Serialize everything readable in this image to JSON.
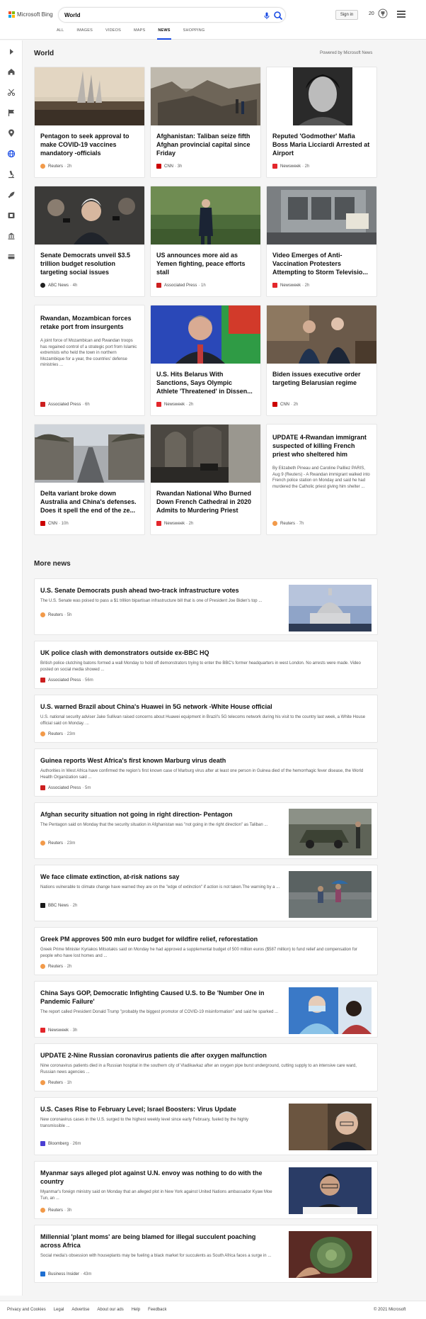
{
  "app": {
    "logo_text": "Microsoft Bing",
    "logo_colors": [
      "#f25022",
      "#7fba00",
      "#00a4ef",
      "#ffb900"
    ],
    "search_value": "World",
    "signin_label": "Sign in",
    "points": "20",
    "accent": "#174ae4"
  },
  "nav": {
    "tabs": [
      {
        "label": "ALL"
      },
      {
        "label": "IMAGES"
      },
      {
        "label": "VIDEOS"
      },
      {
        "label": "MAPS"
      },
      {
        "label": "NEWS",
        "active": true
      },
      {
        "label": "SHOPPING"
      }
    ]
  },
  "rail": {
    "icons": [
      "expand-icon",
      "home-icon",
      "scissors-icon",
      "flag-icon",
      "map-pin-icon",
      "globe-icon",
      "microscope-icon",
      "rocket-icon",
      "film-icon",
      "bank-icon",
      "card-icon"
    ]
  },
  "main": {
    "section_title": "World",
    "powered": "Powered by Microsoft News",
    "cards": [
      {
        "headline": "Pentagon to seek approval to make COVID-19 vaccines mandatory -officials",
        "source": "Reuters",
        "time": "· 2h",
        "icon": "reuters"
      },
      {
        "headline": "Afghanistan: Taliban seize fifth Afghan provincial capital since Friday",
        "source": "CNN",
        "time": "· 3h",
        "icon": "cnn"
      },
      {
        "headline": "Reputed 'Godmother' Mafia Boss Maria Licciardi Arrested at Airport",
        "source": "Newsweek",
        "time": "· 2h",
        "icon": "newsweek"
      },
      {
        "headline": "Senate Democrats unveil $3.5 trillion budget resolution targeting social issues",
        "source": "ABC News",
        "time": "· 4h",
        "icon": "abc"
      },
      {
        "headline": "US announces more aid as Yemen fighting, peace efforts stall",
        "source": "Associated Press",
        "time": "· 1h",
        "icon": "ap"
      },
      {
        "headline": "Video Emerges of Anti-Vaccination Protesters Attempting to Storm Televisio...",
        "source": "Newsweek",
        "time": "· 2h",
        "icon": "newsweek"
      },
      {
        "headline": "Rwandan, Mozambican forces retake port from insurgents",
        "snippet": "A joint force of Mozambican and Rwandan troops has regained control of a strategic port from Islamic extremists who held the town in northern Mozambique for a year, the countries' defense ministries ...",
        "source": "Associated Press",
        "time": "· 6h",
        "icon": "ap"
      },
      {
        "headline": "U.S. Hits Belarus With Sanctions, Says Olympic Athlete 'Threatened' in Dissen...",
        "source": "Newsweek",
        "time": "· 2h",
        "icon": "newsweek"
      },
      {
        "headline": "Biden issues executive order targeting Belarusian regime",
        "source": "CNN",
        "time": "· 2h",
        "icon": "cnn"
      },
      {
        "headline": "Delta variant broke down Australia and China's defenses. Does it spell the end of the ze...",
        "source": "CNN",
        "time": "· 10h",
        "icon": "cnn"
      },
      {
        "headline": "Rwandan National Who Burned Down French Cathedral in 2020 Admits to Murdering Priest",
        "source": "Newsweek",
        "time": "· 2h",
        "icon": "newsweek"
      },
      {
        "headline": "UPDATE 4-Rwandan immigrant suspected of killing French priest who sheltered him",
        "snippet": "By Elizabeth Pineau and Caroline Pailliez PARIS, Aug 9 (Reuters) - A Rwandan immigrant walked into French police station on Monday and said he had murdered the Catholic priest giving him shelter ...",
        "source": "Reuters",
        "time": "· 7h",
        "icon": "reuters"
      }
    ],
    "more_title": "More news",
    "rows": [
      {
        "headline": "U.S. Senate Democrats push ahead two-track infrastructure votes",
        "snippet": "The U.S. Senate was poised to pass a $1 trillion bipartisan infrastructure bill that is one of President Joe Biden's top ...",
        "source": "Reuters",
        "time": "· 5h",
        "icon": "reuters"
      },
      {
        "headline": "UK police clash with demonstrators outside ex-BBC HQ",
        "snippet": "British police clutching batons formed a wall Monday to hold off demonstrators trying to enter the BBC's former headquarters in west London. No arrests were made. Video posted on social media showed ...",
        "source": "Associated Press",
        "time": "· 56m",
        "icon": "ap"
      },
      {
        "headline": "U.S. warned Brazil about China's Huawei in 5G network -White House official",
        "snippet": "U.S. national security adviser Jake Sullivan raised concerns about Huawei equipment in Brazil's 5G telecoms network during his visit to the country last week, a White House official said on Monday. ...",
        "source": "Reuters",
        "time": "· 23m",
        "icon": "reuters"
      },
      {
        "headline": "Guinea reports West Africa's first known Marburg virus death",
        "snippet": "Authorities in West Africa have confirmed the region's first known case of Marburg virus after at least one person in Guinea died of the hemorrhagic fever disease, the World Health Organization said ...",
        "source": "Associated Press",
        "time": "· 5m",
        "icon": "ap"
      },
      {
        "headline": "Afghan security situation not going in right direction- Pentagon",
        "snippet": "The Pentagon said on Monday that the security situation in Afghanistan was \"not going in the right direction\" as Taliban ...",
        "source": "Reuters",
        "time": "· 23m",
        "icon": "reuters"
      },
      {
        "headline": "We face climate extinction, at-risk nations say",
        "snippet": "Nations vulnerable to climate change have warned they are on the \"edge of extinction\" if action is not taken.The warning by a ...",
        "source": "BBC News",
        "time": "· 2h",
        "icon": "bbc"
      },
      {
        "headline": "Greek PM approves 500 mln euro budget for wildfire relief, reforestation",
        "snippet": "Greek Prime Minister Kyriakos Mitsotakis said on Monday he had approved a supplemental budget of 500 million euros ($587 million) to fund relief and compensation for people who have lost homes and ...",
        "source": "Reuters",
        "time": "· 2h",
        "icon": "reuters"
      },
      {
        "headline": "China Says GOP, Democratic Infighting Caused U.S. to Be 'Number One in Pandemic Failure'",
        "snippet": "The report called President Donald Trump \"probably the biggest promotor of COVID-19 misinformation\" and said he sparked ...",
        "source": "Newsweek",
        "time": "· 3h",
        "icon": "newsweek"
      },
      {
        "headline": "UPDATE 2-Nine Russian coronavirus patients die after oxygen malfunction",
        "snippet": "Nine coronavirus patients died in a Russian hospital in the southern city of Vladikavkaz after an oxygen pipe burst underground, cutting supply to an intensive care ward, Russian news agencies ...",
        "source": "Reuters",
        "time": "· 1h",
        "icon": "reuters"
      },
      {
        "headline": "U.S. Cases Rise to February Level; Israel Boosters: Virus Update",
        "snippet": "New coronavirus cases in the U.S. surged to the highest weekly level since early February, fueled by the highly transmissible ...",
        "source": "Bloomberg",
        "time": "· 26m",
        "icon": "bloomberg"
      },
      {
        "headline": "Myanmar says alleged plot against U.N. envoy was nothing to do with the country",
        "snippet": "Myanmar's foreign ministry said on Monday that an alleged plot in New York against United Nations ambassador Kyaw Moe Tun, an ...",
        "source": "Reuters",
        "time": "· 3h",
        "icon": "reuters"
      },
      {
        "headline": "Millennial 'plant moms' are being blamed for illegal succulent poaching across Africa",
        "snippet": "Social media's obsession with houseplants may be fueling a black market for succulents as South Africa faces a surge in ...",
        "source": "Business Insider",
        "time": "· 43m",
        "icon": "bi"
      }
    ]
  },
  "footer": {
    "links": [
      "Privacy and Cookies",
      "Legal",
      "Advertise",
      "About our ads",
      "Help",
      "Feedback"
    ],
    "copyright": "© 2021 Microsoft"
  },
  "source_icon_colors": {
    "reuters": "#f29a4a",
    "cnn": "#cc0000",
    "newsweek": "#e3262b",
    "abc": "#222222",
    "ap": "#cc1f1f",
    "bbc": "#1a1a1a",
    "bloomberg": "#4b3fd3",
    "bi": "#1f6fd1"
  }
}
